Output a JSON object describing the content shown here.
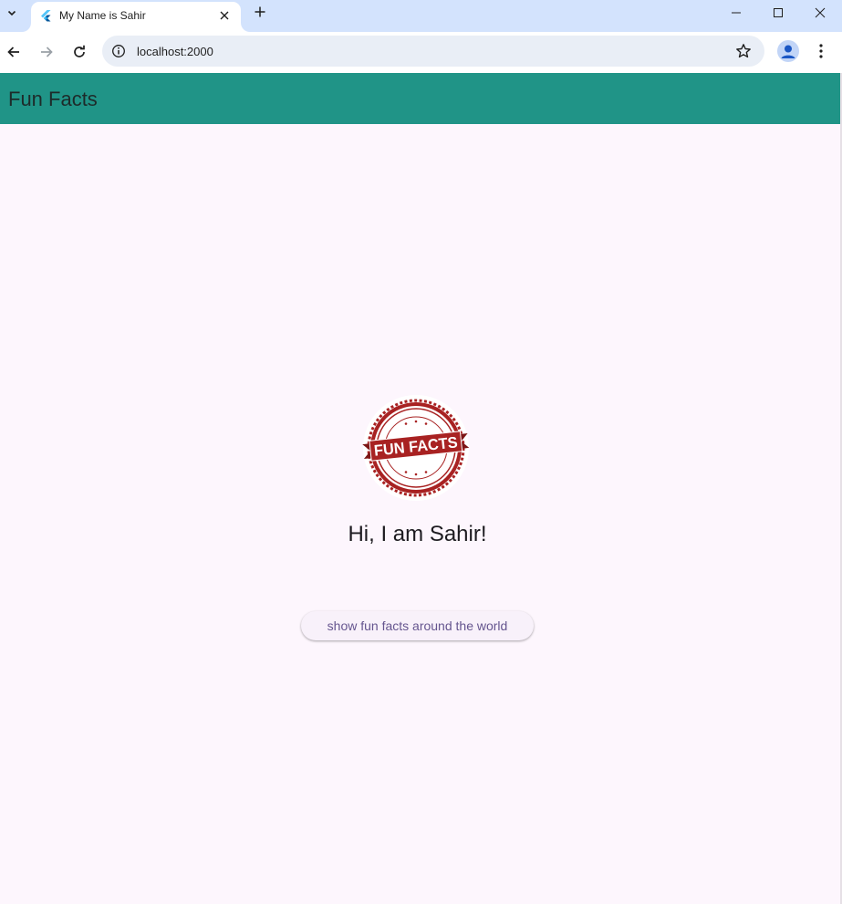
{
  "browser": {
    "tab": {
      "title": "My Name is Sahir"
    },
    "address_bar": {
      "url": "localhost:2000"
    }
  },
  "app": {
    "appbar": {
      "title": "Fun Facts",
      "background": "#209487"
    },
    "logo": {
      "text": "FUN FACTS",
      "color": "#a82222"
    },
    "greeting": "Hi, I am Sahir!",
    "fact_button": {
      "label": "show fun facts around the world",
      "text_color": "#65558f"
    }
  }
}
